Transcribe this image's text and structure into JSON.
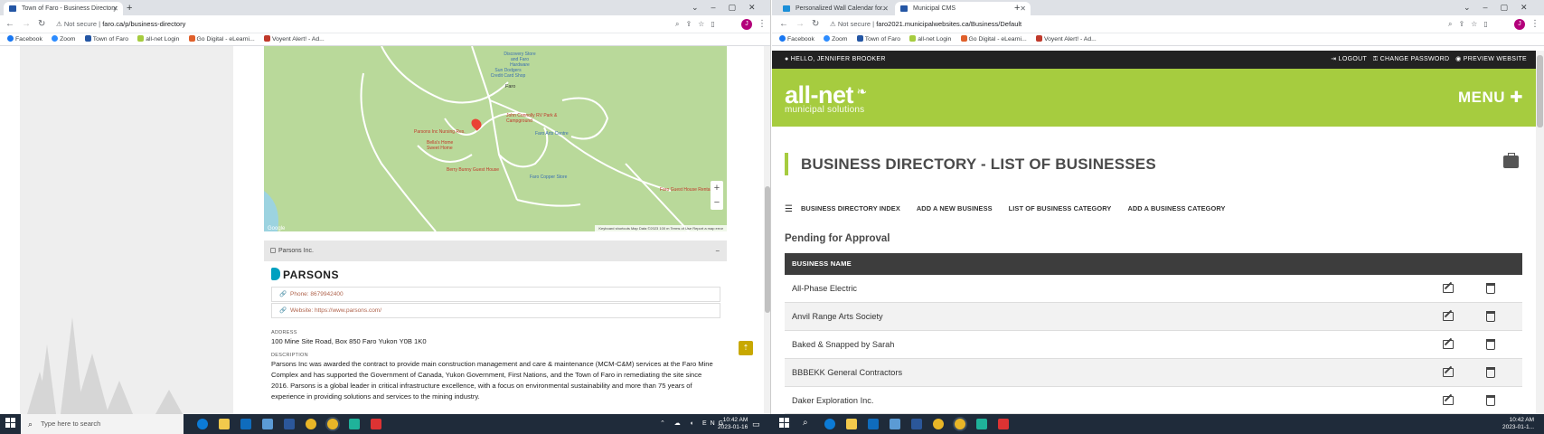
{
  "colors": {
    "brand_green": "#a6cc3f",
    "cms_dark": "#222222",
    "map_green": "#b9d99a",
    "parsons_teal": "#00a0c0"
  },
  "left_window": {
    "tabs": [
      {
        "label": "Town of Faro - Business Directory",
        "active": true,
        "icon": "faro-favicon-icon"
      }
    ],
    "url_prefix": "Not secure",
    "url": "faro.ca/p/business-directory",
    "profile_initial": "J",
    "bookmarks": [
      {
        "label": "Facebook",
        "icon": "facebook-icon"
      },
      {
        "label": "Zoom",
        "icon": "zoom-icon"
      },
      {
        "label": "Town of Faro",
        "icon": "faro-icon"
      },
      {
        "label": "all-net Login",
        "icon": "allnet-icon"
      },
      {
        "label": "Go Digital - eLearni...",
        "icon": "go-digital-icon"
      },
      {
        "label": "Voyent Alert! - Ad...",
        "icon": "voyent-icon"
      }
    ],
    "map": {
      "labels": [
        "Discovery Store and Faro Hardware",
        "Sun Dodgers Credit Card Shop",
        "Faro",
        "John Connolly RV Park & Campground",
        "Faro Arts Centre",
        "Parsons Inc Nursing Res.",
        "Bella's Home Sweet Home",
        "Berry Bunny Guest House",
        "Faro Copper Store",
        "Faro Guest House Rentals"
      ],
      "footer": "Keyboard shortcuts   Map Data ©2023   100 m   Terms of Use   Report a map error",
      "zoom_in": "+",
      "zoom_out": "−",
      "google": "Google"
    },
    "business": {
      "name": "Parsons Inc.",
      "collapse": "−",
      "logo_text": "PARSONS",
      "phone": "Phone: 8679942400",
      "website": "Website: https://www.parsons.com/",
      "address_label": "ADDRESS",
      "address": "100 Mine Site Road, Box 850 Faro Yukon Y0B 1K0",
      "description_label": "DESCRIPTION",
      "description": "Parsons Inc was awarded the contract to provide main construction management and care & maintenance (MCM-C&M) services at the Faro Mine Complex and has supported the Government of Canada, Yukon Government, First Nations, and the Town of Faro in remediating the site since 2016. Parsons is a global leader in critical infrastructure excellence, with a focus on environmental sustainability and more than 75 years of experience in providing solutions and services to the mining industry."
    }
  },
  "right_window": {
    "tabs": [
      {
        "label": "Personalized Wall Calendar for...",
        "active": false,
        "icon": "calendar-favicon-icon"
      },
      {
        "label": "Municipal CMS",
        "active": true,
        "icon": "cms-favicon-icon"
      }
    ],
    "url_prefix": "Not secure",
    "url": "faro2021.municipalwebsites.ca/Business/Default",
    "profile_initial": "J",
    "cms": {
      "hello": "HELLO, JENNIFER BROOKER",
      "logout": "LOGOUT",
      "change_password": "CHANGE PASSWORD",
      "preview": "PREVIEW WEBSITE",
      "logo_main": "all-net",
      "logo_sub": "municipal solutions",
      "menu": "MENU",
      "menu_plus": "✚",
      "page_title": "BUSINESS DIRECTORY - LIST OF BUSINESSES",
      "subnav": [
        "BUSINESS DIRECTORY INDEX",
        "ADD A NEW BUSINESS",
        "LIST OF BUSINESS CATEGORY",
        "ADD A BUSINESS CATEGORY"
      ],
      "section": "Pending for Approval",
      "table_header": "BUSINESS NAME",
      "rows": [
        "All-Phase Electric",
        "Anvil Range Arts Society",
        "Baked & Snapped by Sarah",
        "BBBEKK General Contractors",
        "Daker Exploration Inc."
      ]
    }
  },
  "taskbar": {
    "search_placeholder": "Type here to search",
    "time": "10:42 AM",
    "date": "2023-01-16",
    "lang": "ENG",
    "time_right": "10:42 AM",
    "date_right": "2023-01-1..."
  }
}
